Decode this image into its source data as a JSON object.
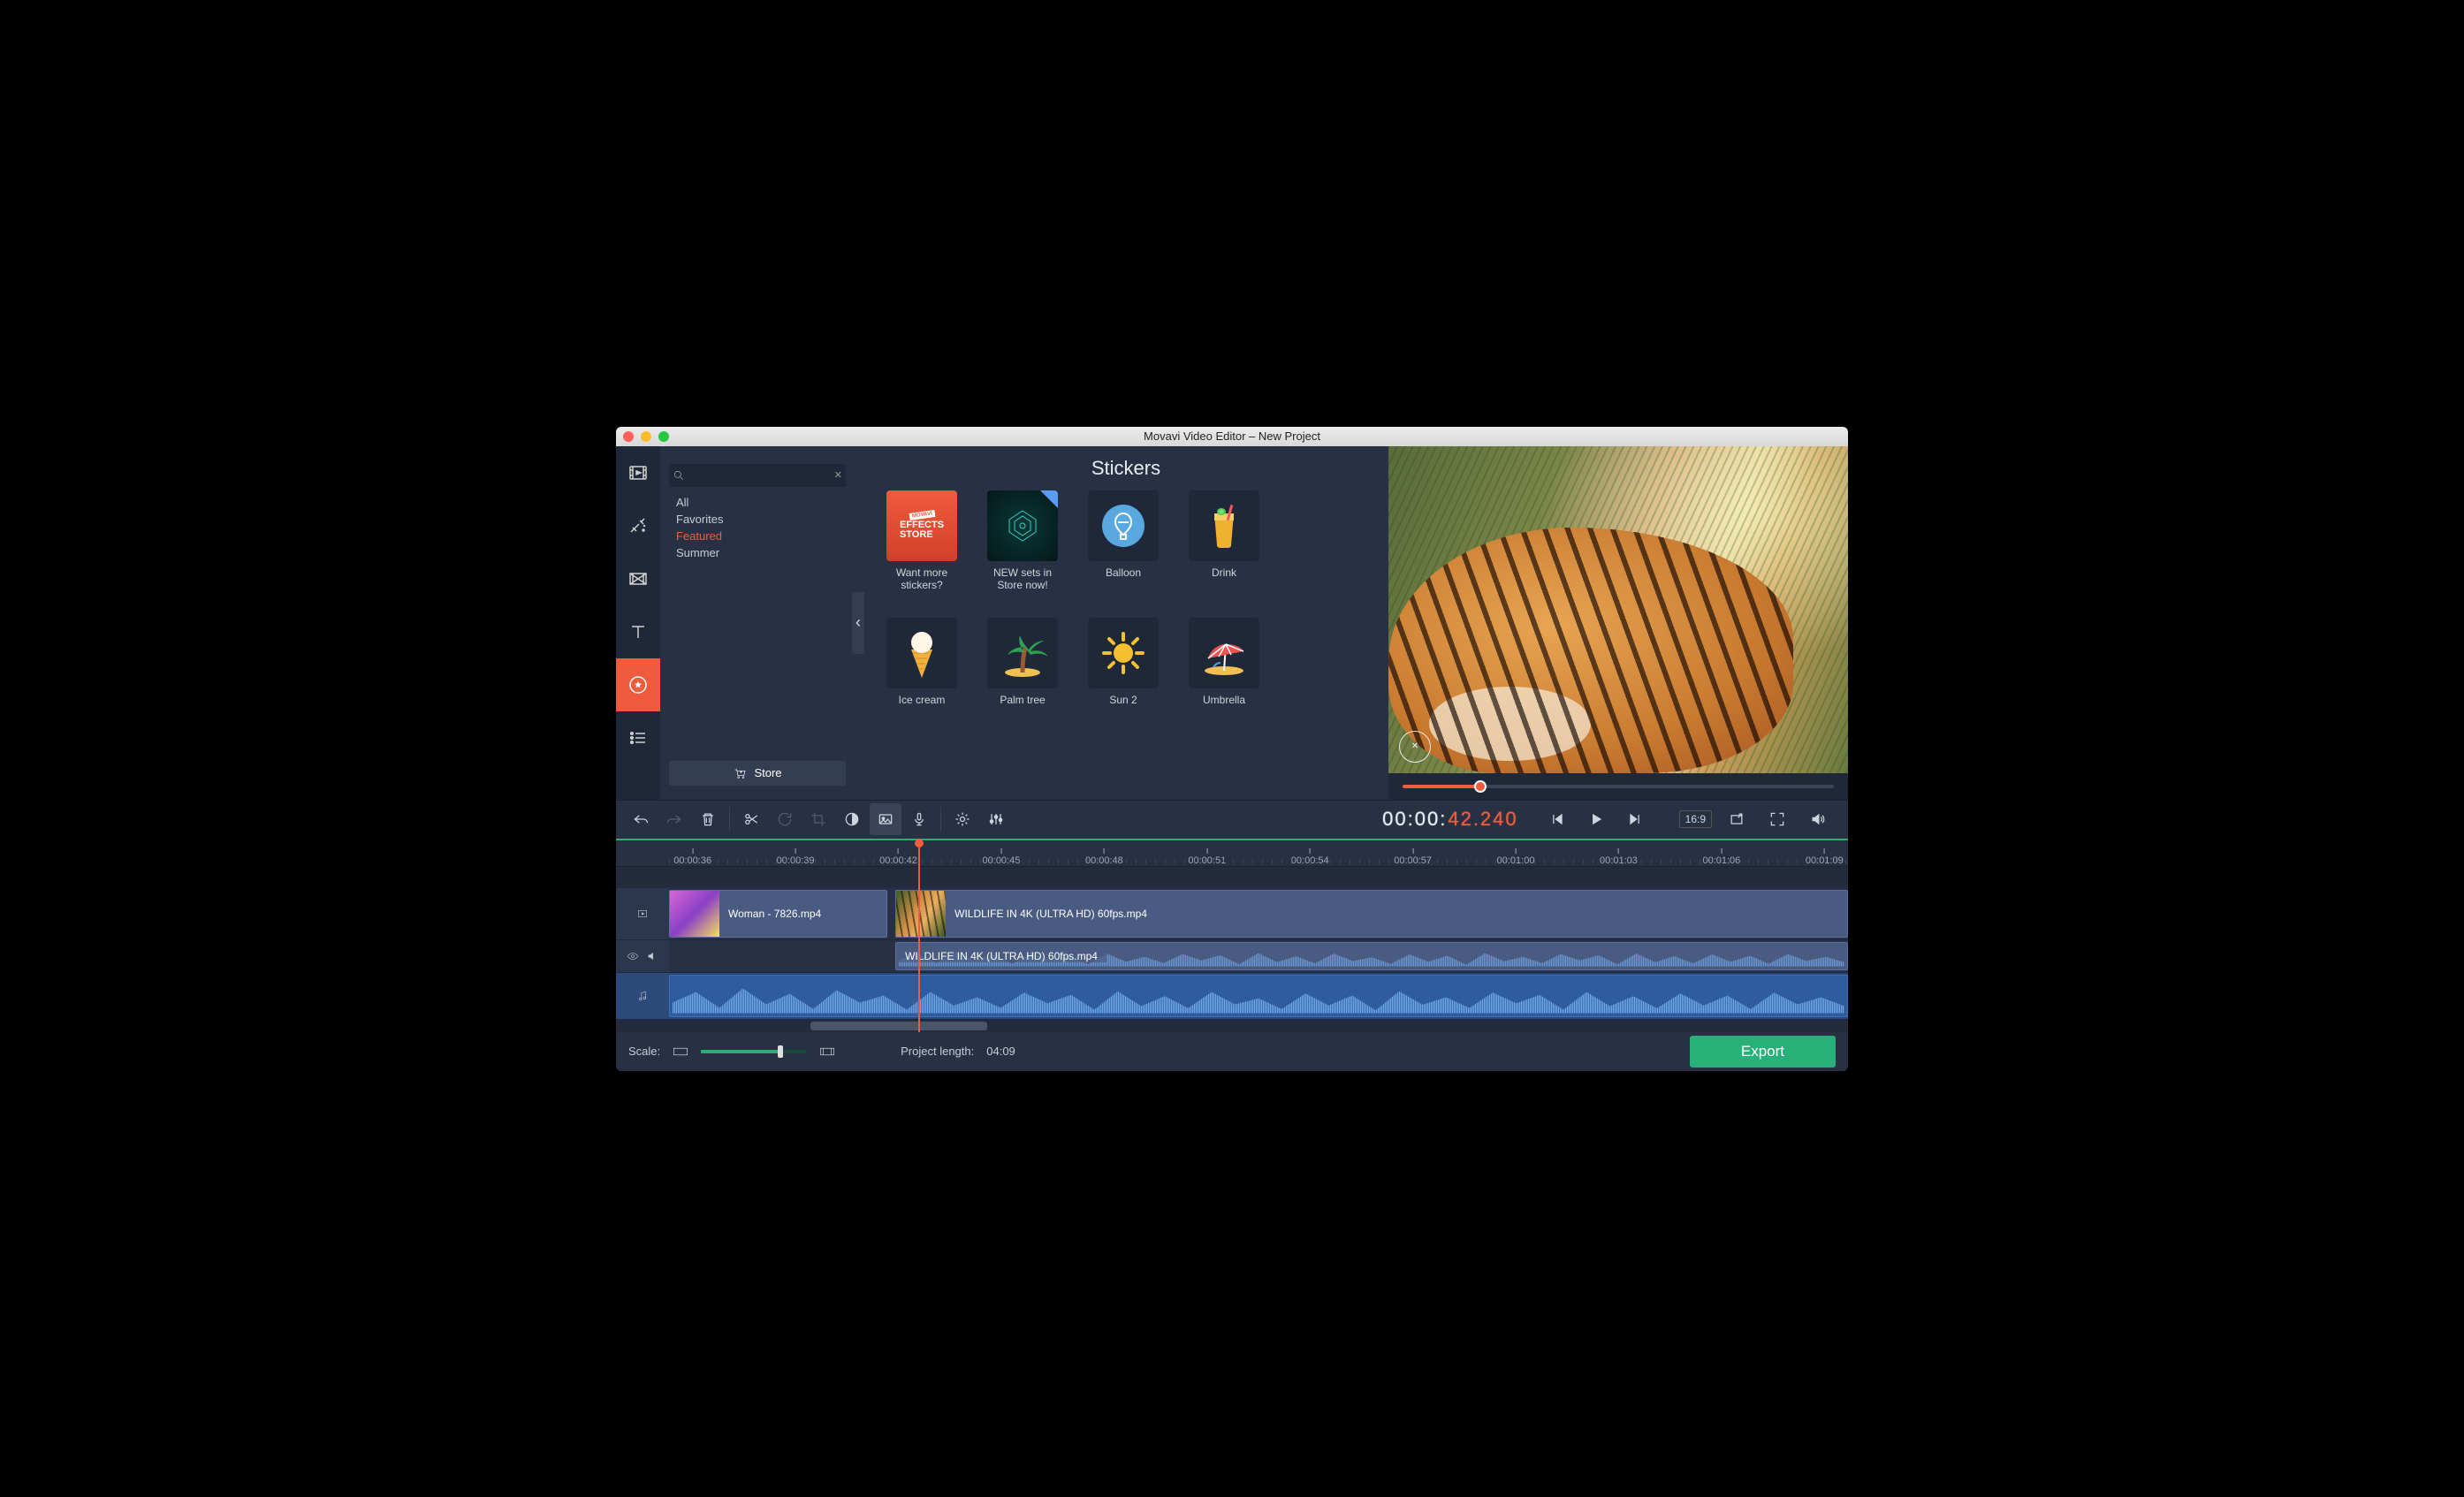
{
  "title": "Movavi Video Editor – New Project",
  "leftbar": {
    "items": [
      "media",
      "magic",
      "transitions",
      "text",
      "stickers",
      "more"
    ],
    "active_index": 4
  },
  "sidepanel": {
    "categories": [
      "All",
      "Favorites",
      "Featured",
      "Summer"
    ],
    "active_category_index": 2,
    "store_label": "Store"
  },
  "content": {
    "title": "Stickers",
    "items": [
      {
        "id": "want-more",
        "label": "Want more stickers?"
      },
      {
        "id": "new-sets",
        "label": "NEW sets in Store now!",
        "badge": "new"
      },
      {
        "id": "balloon",
        "label": "Balloon"
      },
      {
        "id": "drink",
        "label": "Drink"
      },
      {
        "id": "icecream",
        "label": "Ice cream"
      },
      {
        "id": "palmtree",
        "label": "Palm tree"
      },
      {
        "id": "sun2",
        "label": "Sun 2"
      },
      {
        "id": "umbrella",
        "label": "Umbrella"
      }
    ]
  },
  "timecode": {
    "white": "00:00:",
    "orange": "42.240"
  },
  "aspect": "16:9",
  "ruler": {
    "ticks": [
      "00:00:36",
      "00:00:39",
      "00:00:42",
      "00:00:45",
      "00:00:48",
      "00:00:51",
      "00:00:54",
      "00:00:57",
      "00:01:00",
      "00:01:03",
      "00:01:06",
      "00:01:09"
    ]
  },
  "clips": {
    "video1_a": "Woman - 7826.mp4",
    "video1_b": "WILDLIFE IN 4K (ULTRA HD) 60fps.mp4",
    "audio1": "WILDLIFE IN 4K (ULTRA HD) 60fps.mp4"
  },
  "footer": {
    "scale_label": "Scale:",
    "project_length_label": "Project length:",
    "project_length_value": "04:09",
    "export_label": "Export"
  }
}
